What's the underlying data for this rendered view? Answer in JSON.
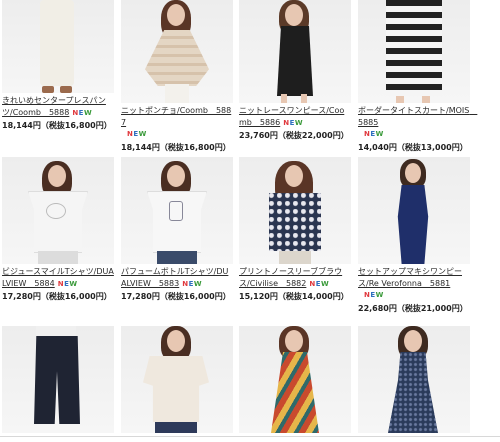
{
  "new_badge": [
    "N",
    "E",
    "W"
  ],
  "row1": [
    {
      "caption": "きれいめセンタープレスパンツ/Coomb　5888",
      "new": true,
      "price": "18,144円（税抜16,800円）",
      "garment": "#f2efe8",
      "skin": "#e7c7b2",
      "hair": "#4a2e22"
    },
    {
      "caption": "ニットポンチョ/Coomb　5887",
      "new": true,
      "price": "18,144円（税抜16,800円）",
      "garment": "#e4d6c4",
      "skin": "#e7c7b2",
      "hair": "#5a3526"
    },
    {
      "caption": "ニットレースワンピース/Coomb　5886",
      "new": true,
      "price": "23,760円（税抜22,000円）",
      "garment": "#1e1e1e",
      "skin": "#e7c7b2",
      "hair": "#5b3a28"
    },
    {
      "caption": "ボーダータイトスカート/MOIS　5885",
      "new": true,
      "price": "14,040円（税抜13,000円）",
      "garment": "#222222",
      "skin": "#e7c7b2",
      "hair": "#4a2e22"
    }
  ],
  "row2": [
    {
      "caption": "ビジュースマイルTシャツ/DUALVIEW　5884",
      "new": true,
      "price": "17,280円（税抜16,000円）",
      "garment": "#f5f5f5",
      "skin": "#e7c7b2",
      "hair": "#4a2e22"
    },
    {
      "caption": "パフュームボトルTシャツ/DUALVIEW　5883",
      "new": true,
      "price": "17,280円（税抜16,000円）",
      "garment": "#f7f7f7",
      "skin": "#e7c7b2",
      "hair": "#4a2e22"
    },
    {
      "caption": "プリントノースリーブブラウス/Civilise　5882",
      "new": true,
      "price": "15,120円（税抜14,000円）",
      "garment": "#2a3550",
      "skin": "#e7c7b2",
      "hair": "#5a3526"
    },
    {
      "caption": "セットアップマキシワンピース/Re Verofonna　5881",
      "new": true,
      "price": "22,680円（税抜21,000円）",
      "garment": "#1f2f6a",
      "skin": "#e7c7b2",
      "hair": "#3e2a20"
    }
  ],
  "row3": [
    {
      "garment": "#1f2433",
      "skin": "#e7c7b2",
      "hair": "#4a2e22"
    },
    {
      "garment": "#efe8de",
      "skin": "#e7c7b2",
      "hair": "#4a2e22"
    },
    {
      "garment": "#c94a2e",
      "skin": "#e7c7b2",
      "hair": "#5a3526"
    },
    {
      "garment": "#2a3a5a",
      "skin": "#e7c7b2",
      "hair": "#3e2a20"
    }
  ]
}
